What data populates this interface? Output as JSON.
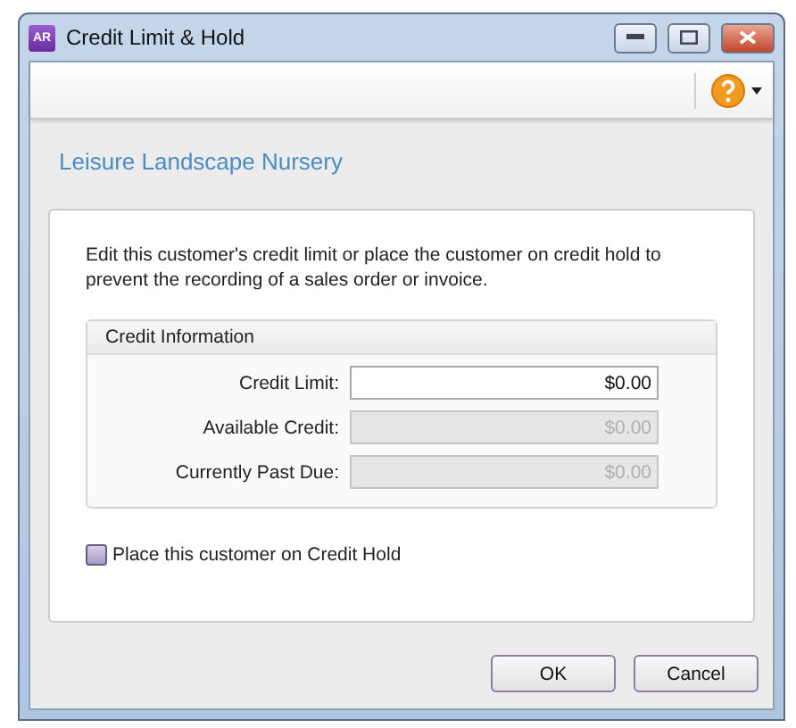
{
  "window": {
    "title": "Credit Limit & Hold",
    "app_badge": "AR"
  },
  "heading": "Leisure Landscape Nursery",
  "description": "Edit this customer's credit limit or place the customer on credit hold to prevent the recording of a sales order or invoice.",
  "group": {
    "title": "Credit Information",
    "fields": [
      {
        "label": "Credit Limit:",
        "value": "$0.00",
        "disabled": false
      },
      {
        "label": "Available Credit:",
        "value": "$0.00",
        "disabled": true
      },
      {
        "label": "Currently Past Due:",
        "value": "$0.00",
        "disabled": true
      }
    ]
  },
  "credit_hold": {
    "label": "Place this customer on Credit Hold",
    "checked": false
  },
  "buttons": [
    "OK",
    "Cancel"
  ]
}
